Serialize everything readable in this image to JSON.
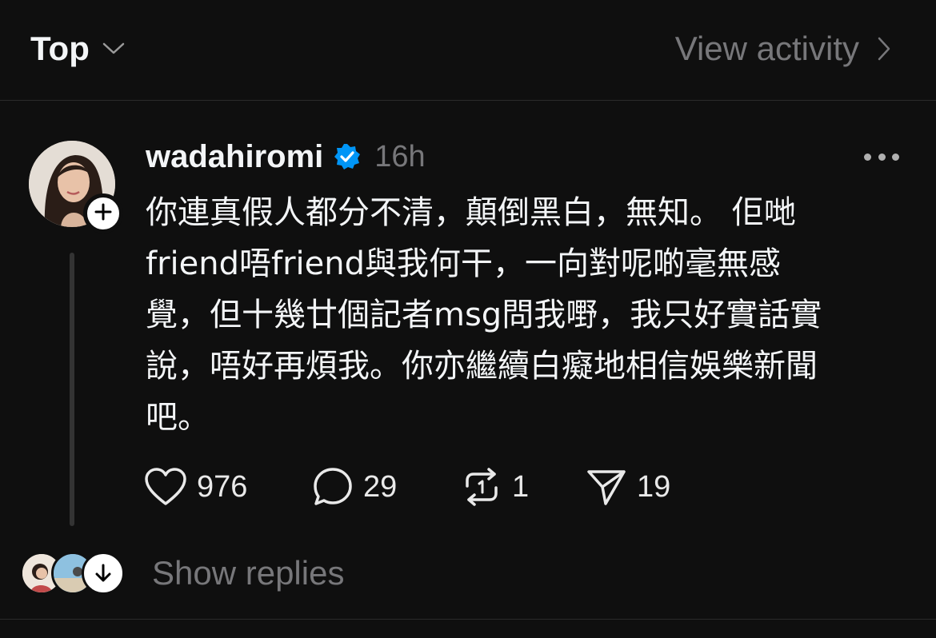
{
  "header": {
    "sort_label": "Top",
    "view_activity_label": "View activity"
  },
  "post": {
    "username": "wadahiromi",
    "verified": true,
    "time": "16h",
    "text_lines": [
      "你連真假人都分不清，顛倒黑白，無知。 佢哋",
      "friend唔friend與我何干，一向對呢啲毫無感",
      "覺，但十幾廿個記者msg問我嘢，我只好實話實",
      "說，唔好再煩我。你亦繼續白癡地相信娛樂新聞",
      "吧。"
    ],
    "likes": "976",
    "replies": "29",
    "reposts": "1",
    "shares": "19"
  },
  "thread": {
    "show_replies_label": "Show replies"
  },
  "colors": {
    "background": "#0f0f0f",
    "text": "#f3f5f7",
    "muted": "#77777a",
    "verified_blue": "#0095f6"
  },
  "icons": [
    "chevron-down-icon",
    "chevron-right-icon",
    "verified-badge-icon",
    "plus-icon",
    "more-icon",
    "heart-icon",
    "comment-icon",
    "repost-icon",
    "send-icon",
    "arrow-down-icon"
  ]
}
